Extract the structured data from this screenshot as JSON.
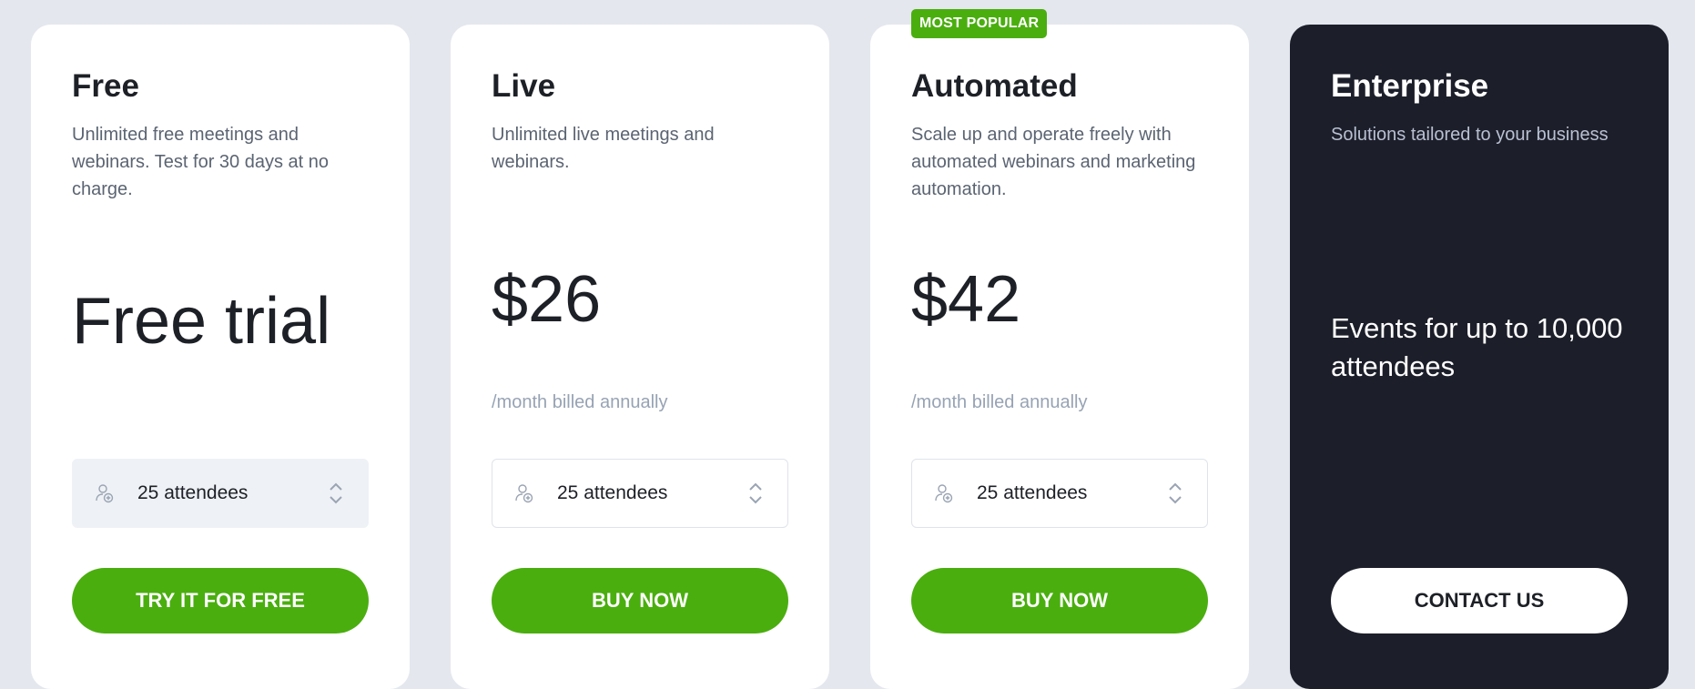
{
  "plans": [
    {
      "name": "Free",
      "description": "Unlimited free meetings and webinars. Test for 30 days at no charge.",
      "price": "Free trial",
      "attendees": "25 attendees",
      "cta": "TRY IT FOR FREE"
    },
    {
      "name": "Live",
      "description": "Unlimited live meetings and webinars.",
      "price": "$26",
      "billing": "/month billed annually",
      "attendees": "25 attendees",
      "cta": "BUY NOW"
    },
    {
      "badge": "MOST POPULAR",
      "name": "Automated",
      "description": "Scale up and operate freely with automated webinars and marketing automation.",
      "price": "$42",
      "billing": "/month billed annually",
      "attendees": "25 attendees",
      "cta": "BUY NOW"
    },
    {
      "name": "Enterprise",
      "description": "Solutions tailored to your business",
      "headline": "Events for up to 10,000 attendees",
      "cta": "CONTACT US"
    }
  ],
  "icons": {
    "attendee": "user-plus-icon",
    "selector_arrows": "chevron-up-down-icon"
  },
  "colors": {
    "accent_green": "#4aae0f",
    "dark_card": "#1c1f2a",
    "background": "#e4e7ee"
  }
}
